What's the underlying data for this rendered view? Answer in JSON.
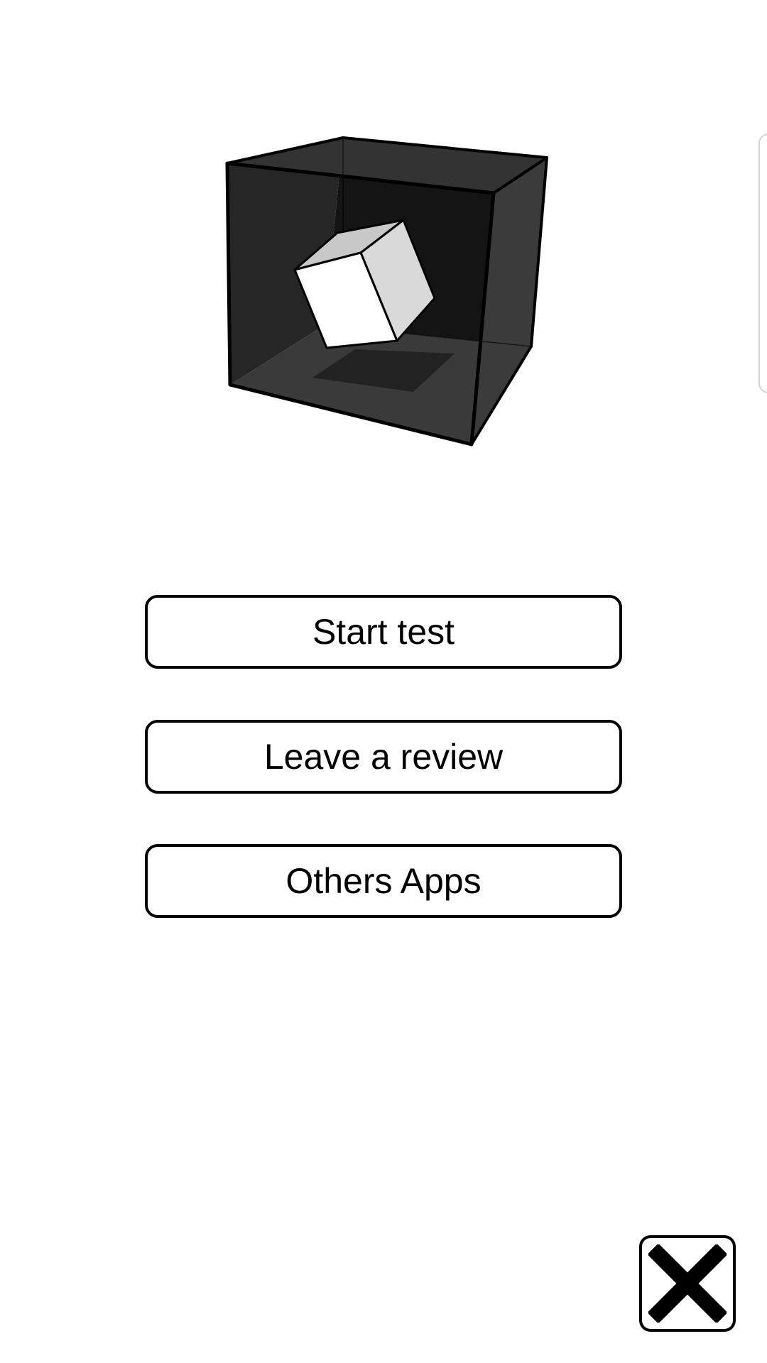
{
  "menu": {
    "start_label": "Start test",
    "review_label": "Leave a review",
    "others_label": "Others Apps"
  },
  "icons": {
    "logo": "cube-in-box-icon",
    "close": "close-icon"
  },
  "colors": {
    "background": "#ffffff",
    "button_border": "#000000",
    "button_text": "#000000"
  }
}
